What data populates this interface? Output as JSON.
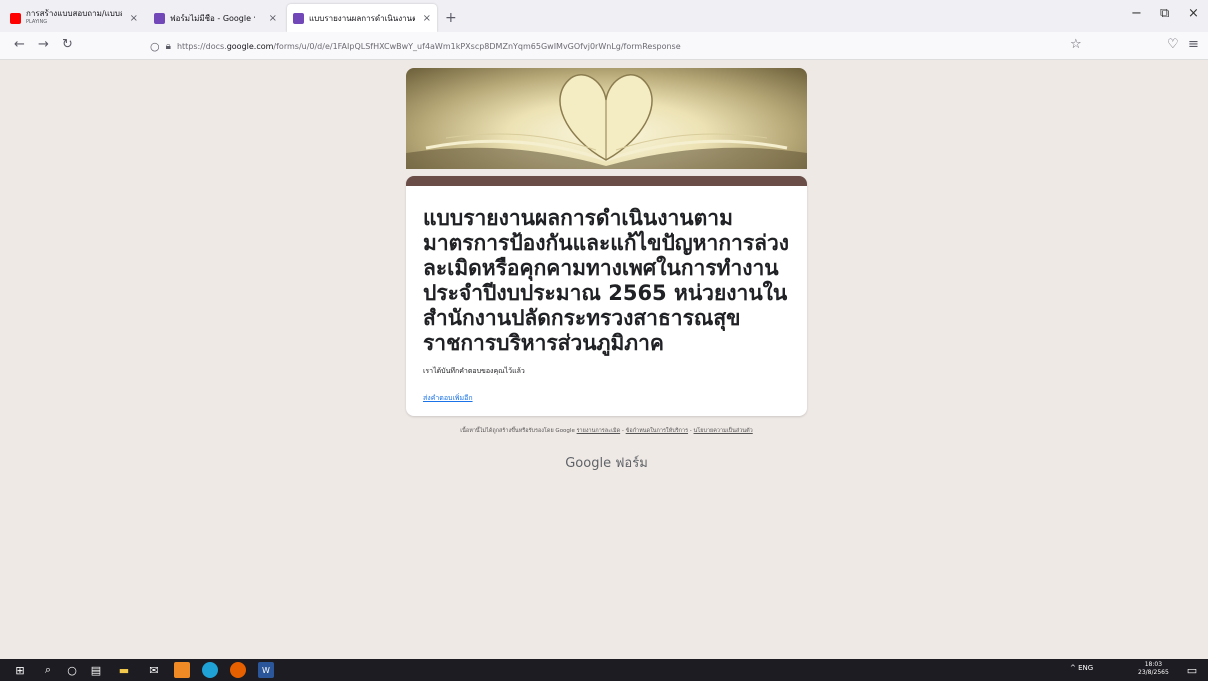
{
  "browser": {
    "tabs": [
      {
        "title": "การสร้างแบบสอบถาม/แบบสำรวจ",
        "subtitle": "PLAYING",
        "close": "×"
      },
      {
        "title": "ฟอร์มไม่มีชื่อ - Google ฟอร์ม",
        "close": "×"
      },
      {
        "title": "แบบรายงานผลการดำเนินงานตาม",
        "close": "×"
      }
    ],
    "new_tab": "+",
    "window_controls": {
      "minimize": "−",
      "maximize": "⧉",
      "close": "×"
    },
    "nav": {
      "back": "←",
      "forward": "→",
      "reload": "↻"
    },
    "url_prefix": "https://docs.",
    "url_host": "google.com",
    "url_path": "/forms/u/0/d/e/1FAIpQLSfHXCwBwY_uf4aWm1kPXscp8DMZnYqm65GwIMvGOfvj0rWnLg/formResponse",
    "bookmark_icon": "☆",
    "pocket_icon": "♡",
    "menu_icon": "≡",
    "colors": {
      "tab_youtube": "#ff0000",
      "tab_forms": "#7248b9"
    }
  },
  "form": {
    "title": "แบบรายงานผลการดำเนินงานตามมาตรการป้องกันและแก้ไขปัญหาการล่วงละเมิดหรือคุกคามทางเพศในการทำงานประจำปีงบประมาณ 2565 หน่วยงานในสำนักงานปลัดกระทรวงสาธารณสุขราชการบริหารส่วนภูมิภาค",
    "confirmation": "เราได้บันทึกคำตอบของคุณไว้แล้ว",
    "submit_another": "ส่งคำตอบเพิ่มอีก",
    "accent_color": "#6b4d47"
  },
  "footer": {
    "note_prefix": "เนื้อหานี้ไม่ได้ถูกสร้างขึ้นหรือรับรองโดย Google ",
    "report_abuse": "รายงานการละเมิด",
    "sep": " - ",
    "terms": "ข้อกำหนดในการให้บริการ",
    "privacy": "นโยบายความเป็นส่วนตัว",
    "brand": "Google ฟอร์ม"
  },
  "taskbar": {
    "tray_text": "^  ENG",
    "time": "18:03",
    "date": "23/8/2565"
  }
}
